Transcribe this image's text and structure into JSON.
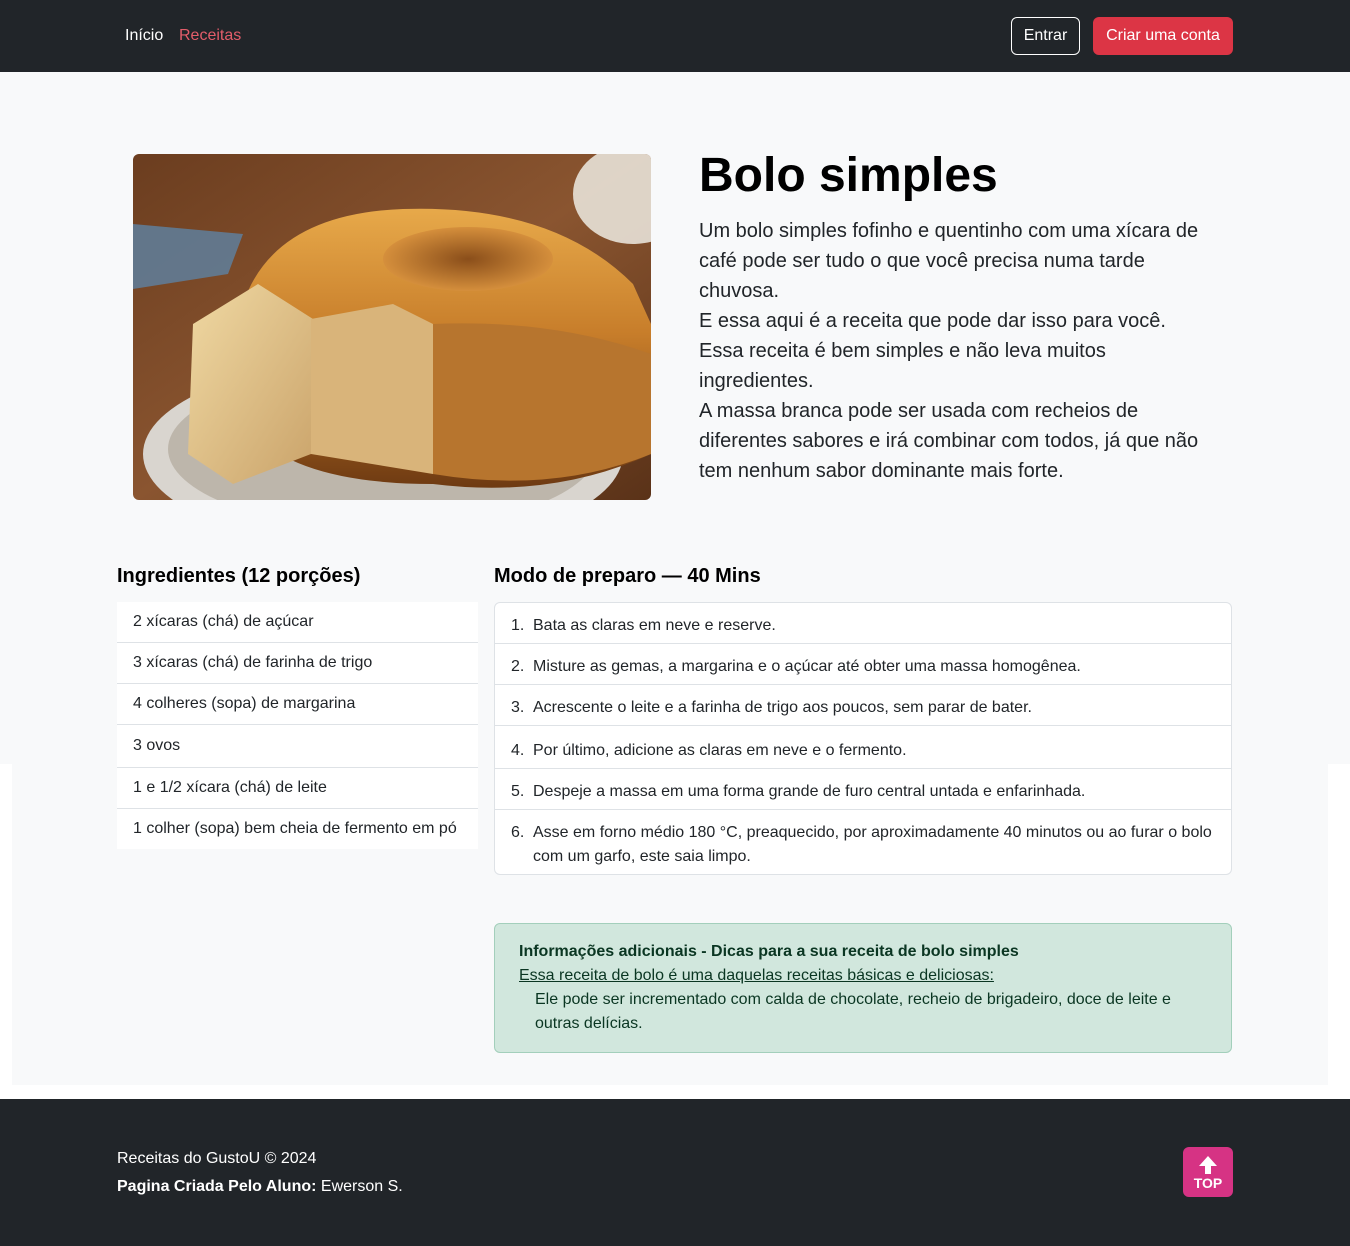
{
  "nav": {
    "links": [
      "Início",
      "Receitas"
    ],
    "login": "Entrar",
    "signup": "Criar uma conta"
  },
  "recipe": {
    "title": "Bolo simples",
    "description": [
      "Um bolo simples fofinho e quentinho com uma xícara de café pode ser tudo o que você precisa numa tarde chuvosa.",
      "E essa aqui é a receita que pode dar isso para você.",
      "Essa receita é bem simples e não leva muitos ingredientes.",
      "A massa branca pode ser usada com recheios de diferentes sabores e irá combinar com todos, já que não tem nenhum sabor dominante mais forte."
    ],
    "ingredients_title": "Ingredientes (12 porções)",
    "ingredients": [
      "2 xícaras (chá) de açúcar",
      "3 xícaras (chá) de farinha de trigo",
      "4 colheres (sopa) de margarina",
      "3 ovos",
      "1 e 1/2 xícara (chá) de leite",
      "1 colher (sopa) bem cheia de fermento em pó"
    ],
    "preparation_title": "Modo de preparo — 40 Mins",
    "steps": [
      {
        "num": "1.",
        "text": "Bata as claras em neve e reserve."
      },
      {
        "num": "2.",
        "text": "Misture as gemas, a margarina e o açúcar até obter uma massa homogênea."
      },
      {
        "num": "3.",
        "text": "Acrescente o leite e a farinha de trigo aos poucos, sem parar de bater."
      },
      {
        "num": "4.",
        "text": "Por último, adicione as claras em neve e o fermento."
      },
      {
        "num": "5.",
        "text": "Despeje a massa em uma forma grande de furo central untada e enfarinhada."
      },
      {
        "num": "6.",
        "text": "Asse em forno médio 180 °C, preaquecido, por aproximadamente 40 minutos ou ao furar o bolo com um garfo, este saia limpo."
      }
    ]
  },
  "info": {
    "title": "Informações adicionais - Dicas para a sua receita de bolo simples",
    "subtitle": "Essa receita de bolo é uma daquelas receitas básicas e deliciosas:",
    "text": "Ele pode ser incrementado com calda de chocolate, recheio de brigadeiro, doce de leite e outras delícias."
  },
  "footer": {
    "copyright": "Receitas do GustoU © 2024",
    "author_label": "Pagina Criada Pelo Aluno:",
    "author_name": "Ewerson S.",
    "top_button": "TOP",
    "top_icon": "arrow-up-icon"
  },
  "colors": {
    "navbar": "#212529",
    "accent": "#dc3545",
    "info_bg": "#d1e7dd",
    "top_button": "#d63384"
  }
}
